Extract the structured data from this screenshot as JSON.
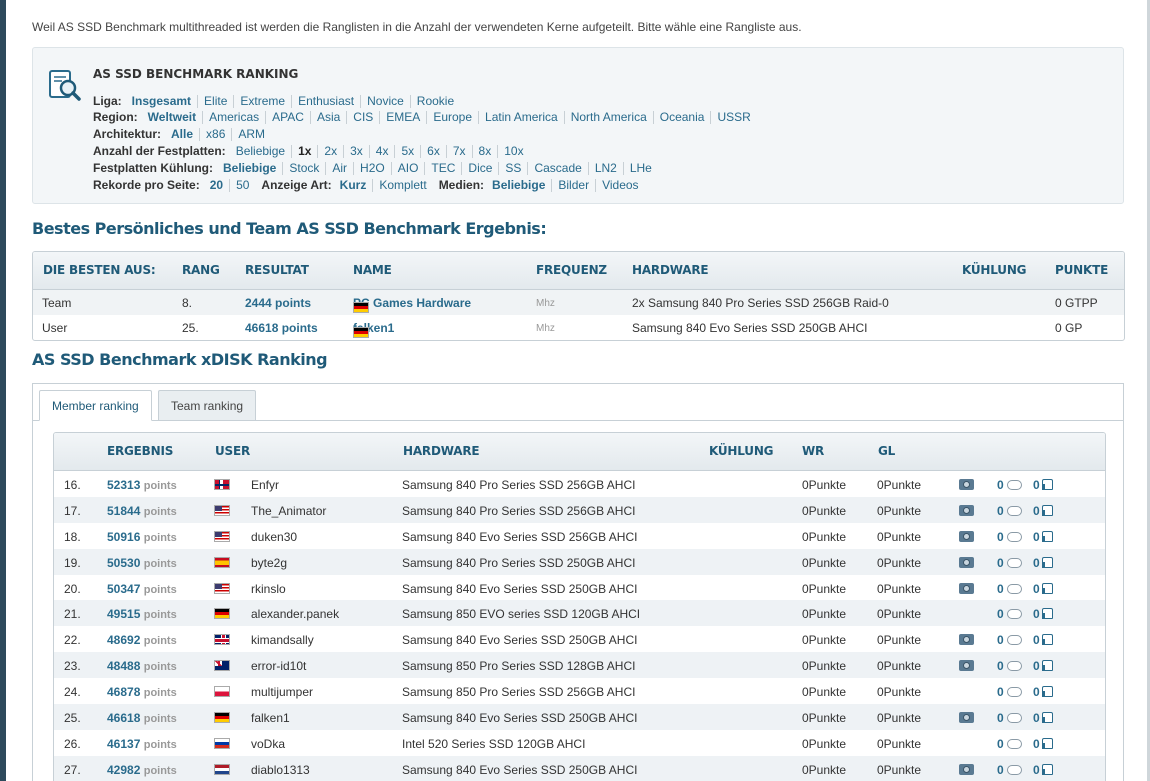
{
  "intro": "Weil AS SSD Benchmark multithreaded ist werden die Ranglisten in die Anzahl der verwendeten Kerne aufgeteilt. Bitte wähle eine Rangliste aus.",
  "filter": {
    "title": "AS SSD BENCHMARK RANKING",
    "icon": "magnifier-document-icon",
    "liga": {
      "label": "Liga:",
      "options": [
        "Insgesamt",
        "Elite",
        "Extreme",
        "Enthusiast",
        "Novice",
        "Rookie"
      ],
      "selected": "Insgesamt"
    },
    "region": {
      "label": "Region:",
      "options": [
        "Weltweit",
        "Americas",
        "APAC",
        "Asia",
        "CIS",
        "EMEA",
        "Europe",
        "Latin America",
        "North America",
        "Oceania",
        "USSR"
      ],
      "selected": "Weltweit"
    },
    "arch": {
      "label": "Architektur:",
      "options": [
        "Alle",
        "x86",
        "ARM"
      ],
      "selected": "Alle"
    },
    "disks": {
      "label": "Anzahl der Festplatten:",
      "options": [
        "Beliebige",
        "1x",
        "2x",
        "3x",
        "4x",
        "5x",
        "6x",
        "7x",
        "8x",
        "10x"
      ],
      "selected": "1x"
    },
    "cooling": {
      "label": "Festplatten Kühlung:",
      "options": [
        "Beliebige",
        "Stock",
        "Air",
        "H2O",
        "AIO",
        "TEC",
        "Dice",
        "SS",
        "Cascade",
        "LN2",
        "LHe"
      ],
      "selected": "Beliebige"
    },
    "perpage": {
      "label": "Rekorde pro Seite:",
      "options": [
        "20",
        "50"
      ],
      "selected": "20"
    },
    "display": {
      "label": "Anzeige Art:",
      "options": [
        "Kurz",
        "Komplett"
      ],
      "selected": "Kurz"
    },
    "media": {
      "label": "Medien:",
      "options": [
        "Beliebige",
        "Bilder",
        "Videos"
      ],
      "selected": "Beliebige"
    }
  },
  "best": {
    "title": "Bestes Persönliches und Team AS SSD Benchmark Ergebnis:",
    "headers": [
      "DIE BESTEN AUS:",
      "RANG",
      "RESULTAT",
      "NAME",
      "FREQUENZ",
      "HARDWARE",
      "KÜHLUNG",
      "PUNKTE"
    ],
    "rows": [
      {
        "type": "Team",
        "rank": "8.",
        "result": "2444 points",
        "flag": "de",
        "name": "PC Games Hardware",
        "freq": "Mhz",
        "hardware": "2x Samsung 840 Pro Series SSD 256GB Raid-0",
        "cooling": "",
        "points": "0 GTPP"
      },
      {
        "type": "User",
        "rank": "25.",
        "result": "46618 points",
        "flag": "de",
        "name": "falken1",
        "freq": "Mhz",
        "hardware": "Samsung 840 Evo Series SSD 250GB AHCI",
        "cooling": "",
        "points": "0 GP"
      }
    ]
  },
  "ranking": {
    "title": "AS SSD Benchmark xDISK Ranking",
    "tabs": [
      "Member ranking",
      "Team ranking"
    ],
    "active_tab": "Member ranking",
    "headers": [
      "ERGEBNIS",
      "USER",
      "HARDWARE",
      "KÜHLUNG",
      "WR",
      "GL"
    ],
    "points_word": "points",
    "rows": [
      {
        "rank": "16.",
        "score": "52313",
        "flag": "no",
        "user": "Enfyr",
        "hardware": "Samsung 840 Pro Series SSD 256GB AHCI",
        "wr": "0Punkte",
        "gl": "0Punkte",
        "cam": true,
        "comments": "0",
        "likes": "0"
      },
      {
        "rank": "17.",
        "score": "51844",
        "flag": "us",
        "user": "The_Animator",
        "hardware": "Samsung 840 Pro Series SSD 256GB AHCI",
        "wr": "0Punkte",
        "gl": "0Punkte",
        "cam": true,
        "comments": "0",
        "likes": "0"
      },
      {
        "rank": "18.",
        "score": "50916",
        "flag": "us",
        "user": "duken30",
        "hardware": "Samsung 840 Evo Series SSD 256GB AHCI",
        "wr": "0Punkte",
        "gl": "0Punkte",
        "cam": true,
        "comments": "0",
        "likes": "0"
      },
      {
        "rank": "19.",
        "score": "50530",
        "flag": "es",
        "user": "byte2g",
        "hardware": "Samsung 840 Pro Series SSD 250GB AHCI",
        "wr": "0Punkte",
        "gl": "0Punkte",
        "cam": true,
        "comments": "0",
        "likes": "0"
      },
      {
        "rank": "20.",
        "score": "50347",
        "flag": "us",
        "user": "rkinslo",
        "hardware": "Samsung 840 Evo Series SSD 250GB AHCI",
        "wr": "0Punkte",
        "gl": "0Punkte",
        "cam": true,
        "comments": "0",
        "likes": "0"
      },
      {
        "rank": "21.",
        "score": "49515",
        "flag": "de",
        "user": "alexander.panek",
        "hardware": "Samsung 850 EVO series SSD 120GB AHCI",
        "wr": "0Punkte",
        "gl": "0Punkte",
        "cam": false,
        "comments": "0",
        "likes": "0"
      },
      {
        "rank": "22.",
        "score": "48692",
        "flag": "gb",
        "user": "kimandsally",
        "hardware": "Samsung 840 Evo Series SSD 250GB AHCI",
        "wr": "0Punkte",
        "gl": "0Punkte",
        "cam": true,
        "comments": "0",
        "likes": "0"
      },
      {
        "rank": "23.",
        "score": "48488",
        "flag": "au",
        "user": "error-id10t",
        "hardware": "Samsung 850 Pro Series SSD 128GB AHCI",
        "wr": "0Punkte",
        "gl": "0Punkte",
        "cam": true,
        "comments": "0",
        "likes": "0"
      },
      {
        "rank": "24.",
        "score": "46878",
        "flag": "pl",
        "user": "multijumper",
        "hardware": "Samsung 850 Pro Series SSD 256GB AHCI",
        "wr": "0Punkte",
        "gl": "0Punkte",
        "cam": false,
        "comments": "0",
        "likes": "0"
      },
      {
        "rank": "25.",
        "score": "46618",
        "flag": "de",
        "user": "falken1",
        "hardware": "Samsung 840 Evo Series SSD 250GB AHCI",
        "wr": "0Punkte",
        "gl": "0Punkte",
        "cam": true,
        "comments": "0",
        "likes": "0"
      },
      {
        "rank": "26.",
        "score": "46137",
        "flag": "ru",
        "user": "voDka",
        "hardware": "Intel 520 Series SSD 120GB AHCI",
        "wr": "0Punkte",
        "gl": "0Punkte",
        "cam": false,
        "comments": "0",
        "likes": "0"
      },
      {
        "rank": "27.",
        "score": "42982",
        "flag": "nl",
        "user": "diablo1313",
        "hardware": "Samsung 840 Evo Series SSD 250GB AHCI",
        "wr": "0Punkte",
        "gl": "0Punkte",
        "cam": true,
        "comments": "0",
        "likes": "0"
      }
    ]
  }
}
